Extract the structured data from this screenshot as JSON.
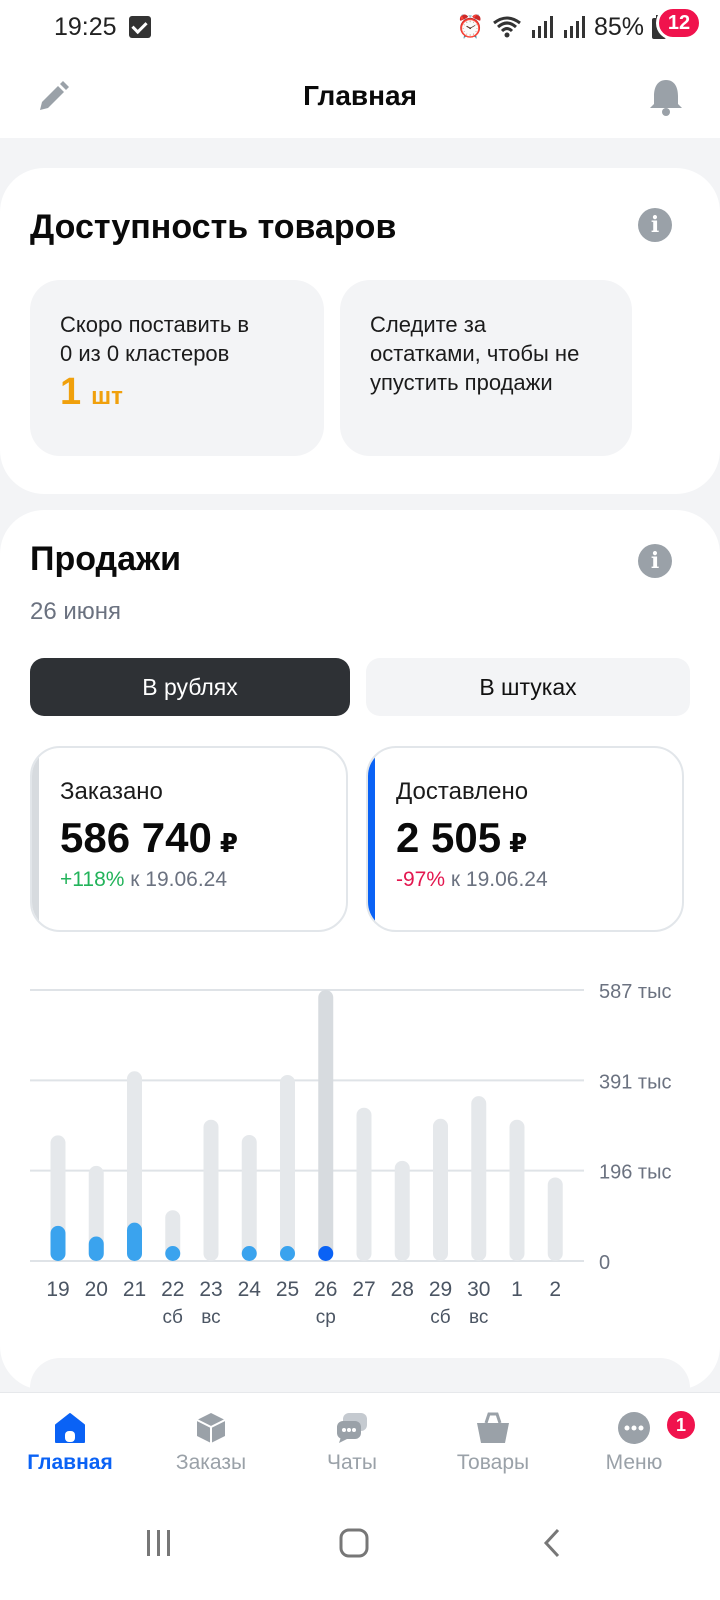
{
  "status": {
    "time": "19:25",
    "battery": "85%"
  },
  "header": {
    "title": "Главная",
    "notifications": "12"
  },
  "availability": {
    "title": "Доступность товаров",
    "tile1": {
      "line1": "Скоро поставить в",
      "line2": "0 из 0 кластеров",
      "value": "1",
      "unit": "шт"
    },
    "tile2": {
      "text": "Следите за остатками, чтобы не упустить продажи"
    }
  },
  "sales": {
    "title": "Продажи",
    "date": "26 июня",
    "toggle": {
      "rub": "В рублях",
      "pcs": "В штуках"
    },
    "ordered": {
      "label": "Заказано",
      "value": "586 740",
      "currency": "₽",
      "delta": "+118%",
      "delta_suffix": "к 19.06.24"
    },
    "delivered": {
      "label": "Доставлено",
      "value": "2 505",
      "currency": "₽",
      "delta": "-97%",
      "delta_suffix": "к 19.06.24"
    }
  },
  "chart_data": {
    "type": "bar",
    "categories": [
      "19",
      "20",
      "21",
      "22",
      "23",
      "24",
      "25",
      "26",
      "27",
      "28",
      "29",
      "30",
      "1",
      "2"
    ],
    "day_labels": [
      "",
      "",
      "",
      "сб",
      "вс",
      "",
      "",
      "ср",
      "",
      "",
      "сб",
      "вс",
      "",
      ""
    ],
    "y_ticks": [
      "587 тыс",
      "391 тыс",
      "196 тыс",
      "0"
    ],
    "ylim": [
      0,
      587
    ],
    "selected_index": 7,
    "series": [
      {
        "values": [
          272,
          206,
          411,
          110,
          306,
          273,
          403,
          587,
          332,
          217,
          308,
          357,
          306,
          181
        ]
      },
      {
        "values": [
          76,
          53,
          83,
          13,
          0,
          13,
          13,
          13,
          0,
          0,
          0,
          0,
          0,
          0
        ]
      }
    ],
    "colors": {
      "track": "#e5e8eb",
      "track_selected": "#d7dbdf",
      "fill": "#3aa3ee",
      "fill_selected": "#0a62f5",
      "grid": "#dfe3e7"
    }
  },
  "tabs": [
    {
      "label": "Главная"
    },
    {
      "label": "Заказы"
    },
    {
      "label": "Чаты"
    },
    {
      "label": "Товары"
    },
    {
      "label": "Меню"
    }
  ],
  "menu_badge": "1"
}
